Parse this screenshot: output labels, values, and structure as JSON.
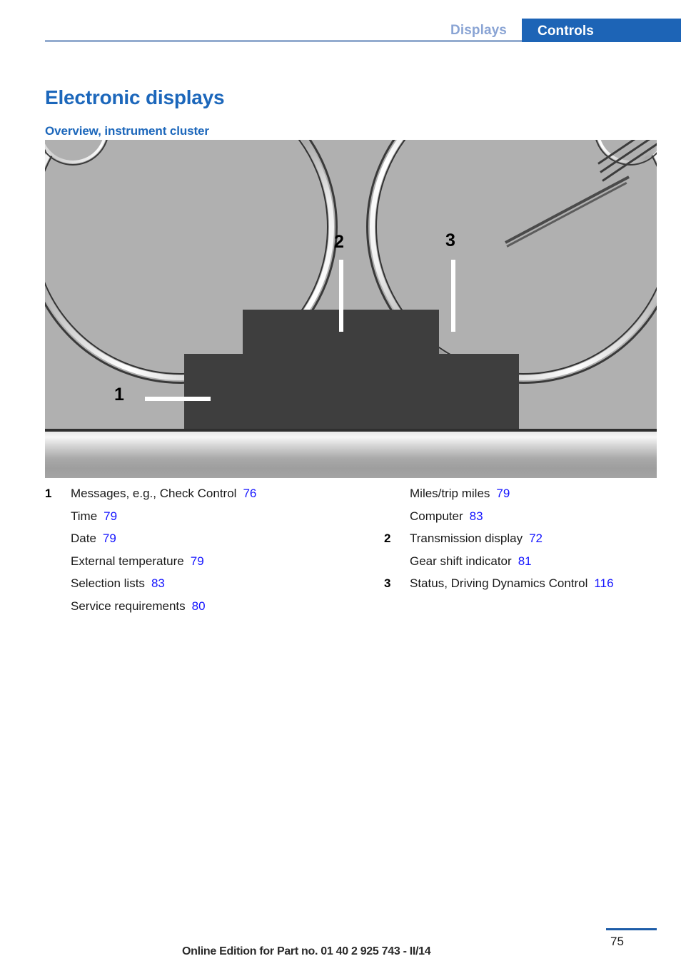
{
  "header": {
    "tab_inactive": "Displays",
    "tab_active": "Controls"
  },
  "title": "Electronic displays",
  "subtitle": "Overview, instrument cluster",
  "illustration": {
    "alt": "instrument-cluster-diagram",
    "callouts": [
      {
        "number": "1"
      },
      {
        "number": "2"
      },
      {
        "number": "3"
      }
    ]
  },
  "legend": {
    "left": [
      {
        "index": "1",
        "label": "Messages, e.g., Check Control",
        "page": "76"
      },
      {
        "index": "",
        "label": "Time",
        "page": "79"
      },
      {
        "index": "",
        "label": "Date",
        "page": "79"
      },
      {
        "index": "",
        "label": "External temperature",
        "page": "79"
      },
      {
        "index": "",
        "label": "Selection lists",
        "page": "83"
      },
      {
        "index": "",
        "label": "Service requirements",
        "page": "80"
      }
    ],
    "right": [
      {
        "index": "",
        "label": "Miles/trip miles",
        "page": "79"
      },
      {
        "index": "",
        "label": "Computer",
        "page": "83"
      },
      {
        "index": "2",
        "label": "Transmission display",
        "page": "72"
      },
      {
        "index": "",
        "label": "Gear shift indicator",
        "page": "81"
      },
      {
        "index": "3",
        "label": "Status, Driving Dynamics Control",
        "page": "116"
      }
    ]
  },
  "footer": {
    "edition": "Online Edition for Part no. 01 40 2 925 743 - II/14",
    "page_number": "75"
  },
  "colors": {
    "brand_blue": "#1c67bb",
    "tab_blue": "#1d64b6",
    "tab_inactive_blue": "#8aa4d4",
    "link_blue": "#1414ff",
    "rule_blue": "#94accf"
  }
}
